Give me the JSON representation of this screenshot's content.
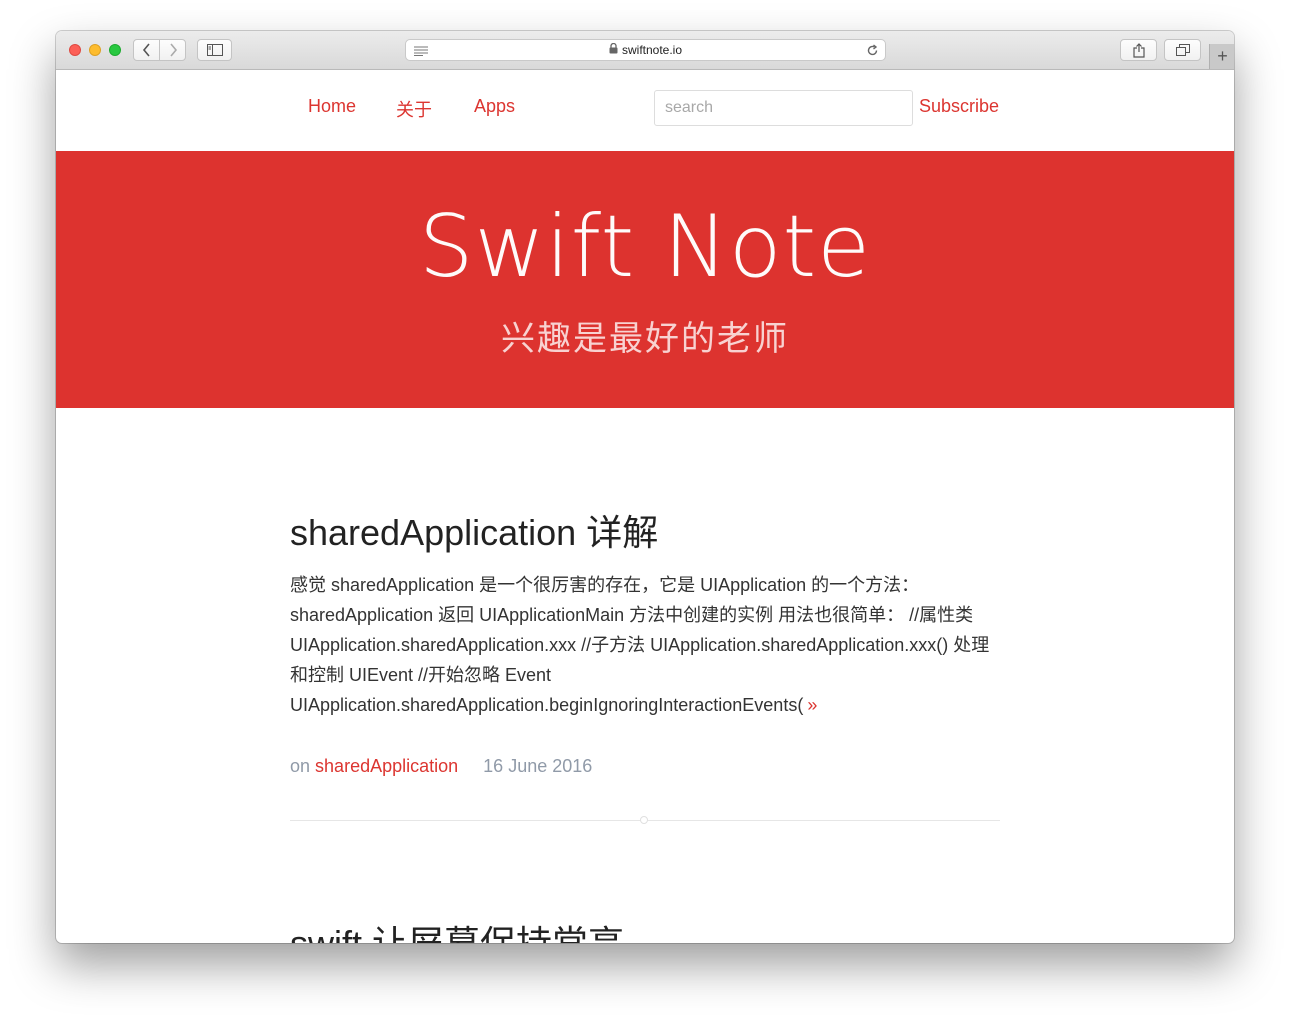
{
  "browser": {
    "url": "swiftnote.io",
    "icons": [
      "back-icon",
      "forward-icon",
      "sidebar-icon",
      "reader-icon",
      "lock-icon",
      "reload-icon",
      "share-icon",
      "tabs-icon",
      "plus-icon"
    ],
    "new_tab_label": "+"
  },
  "nav": {
    "items": [
      {
        "label": "Home"
      },
      {
        "label": "关于"
      },
      {
        "label": "Apps"
      }
    ],
    "search_placeholder": "search",
    "subscribe_label": "Subscribe"
  },
  "hero": {
    "title": "Swift Note",
    "subtitle": "兴趣是最好的老师"
  },
  "posts": [
    {
      "title": "sharedApplication 详解",
      "excerpt": "感觉 sharedApplication 是一个很厉害的存在，它是 UIApplication 的一个方法：sharedApplication 返回 UIApplicationMain 方法中创建的实例 用法也很简单： //属性类 UIApplication.sharedApplication.xxx //子方法 UIApplication.sharedApplication.xxx() 处理和控制 UIEvent //开始忽略 Event UIApplication.sharedApplication.beginIgnoringInteractionEvents(",
      "more_label": "»",
      "meta_prefix": "on",
      "tag": "sharedApplication",
      "date": "16 June 2016"
    },
    {
      "title": "swift 让屏幕保持常亮"
    }
  ],
  "colors": {
    "accent": "#dd332f",
    "meta_gray": "#909aa8"
  }
}
